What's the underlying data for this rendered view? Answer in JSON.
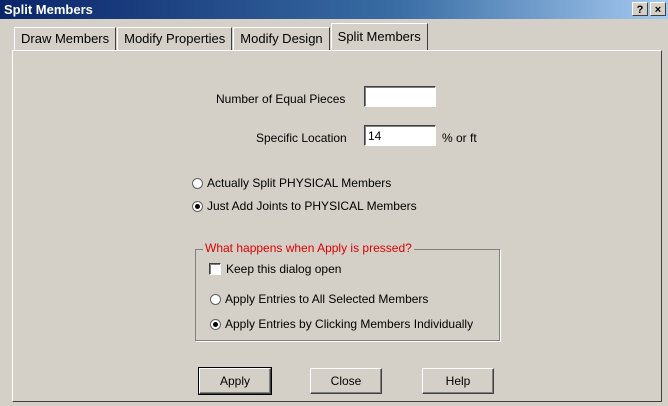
{
  "window": {
    "title": "Split Members",
    "help_label": "?",
    "close_label": "×"
  },
  "tabs": [
    {
      "label": "Draw Members"
    },
    {
      "label": "Modify Properties"
    },
    {
      "label": "Modify Design"
    },
    {
      "label": "Split Members"
    }
  ],
  "form": {
    "equal_pieces_label": "Number of Equal Pieces",
    "equal_pieces_value": "",
    "specific_location_label": "Specific Location",
    "specific_location_value": "14",
    "specific_location_unit": "% or ft"
  },
  "split_options": {
    "actually_split_label": "Actually Split PHYSICAL Members",
    "just_add_joints_label": "Just Add Joints to PHYSICAL Members",
    "selected": "just_add_joints"
  },
  "apply_group": {
    "legend": "What happens when Apply is pressed?",
    "keep_open_label": "Keep this dialog open",
    "keep_open_checked": false,
    "apply_all_label": "Apply Entries to All Selected Members",
    "apply_click_label": "Apply Entries by Clicking Members Individually",
    "selected": "apply_click"
  },
  "buttons": {
    "apply": "Apply",
    "close": "Close",
    "help": "Help"
  },
  "colors": {
    "legend_text": "#e00000",
    "dialog_bg": "#d4d0c8"
  }
}
